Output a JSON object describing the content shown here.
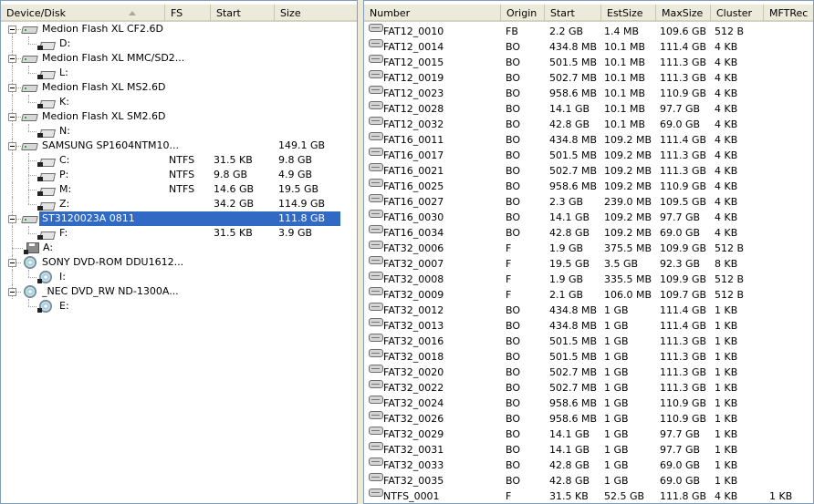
{
  "left_pane": {
    "columns": [
      "Device/Disk",
      "FS",
      "Start",
      "Size"
    ],
    "tree": [
      {
        "kind": "device",
        "icon": "hard-disk-icon",
        "label": "Medion Flash XL CF2.6D",
        "fs": "",
        "start": "",
        "size": "",
        "selected": false
      },
      {
        "kind": "volume",
        "icon": "volume-icon",
        "label": "D:",
        "fs": "",
        "start": "",
        "size": ""
      },
      {
        "kind": "device",
        "icon": "hard-disk-icon",
        "label": "Medion Flash XL MMC/SD2...",
        "fs": "",
        "start": "",
        "size": "",
        "selected": false
      },
      {
        "kind": "volume",
        "icon": "volume-icon",
        "label": "L:",
        "fs": "",
        "start": "",
        "size": ""
      },
      {
        "kind": "device",
        "icon": "hard-disk-icon",
        "label": "Medion Flash XL MS2.6D",
        "fs": "",
        "start": "",
        "size": "",
        "selected": false
      },
      {
        "kind": "volume",
        "icon": "volume-icon",
        "label": "K:",
        "fs": "",
        "start": "",
        "size": ""
      },
      {
        "kind": "device",
        "icon": "hard-disk-icon",
        "label": "Medion Flash XL SM2.6D",
        "fs": "",
        "start": "",
        "size": "",
        "selected": false
      },
      {
        "kind": "volume",
        "icon": "volume-icon",
        "label": "N:",
        "fs": "",
        "start": "",
        "size": ""
      },
      {
        "kind": "device",
        "icon": "hard-disk-icon",
        "label": "SAMSUNG SP1604NTM10...",
        "fs": "",
        "start": "",
        "size": "149.1 GB",
        "selected": false
      },
      {
        "kind": "volume",
        "icon": "volume-icon",
        "label": "C:",
        "fs": "NTFS",
        "start": "31.5 KB",
        "size": "9.8 GB"
      },
      {
        "kind": "volume",
        "icon": "volume-icon",
        "label": "P:",
        "fs": "NTFS",
        "start": "9.8 GB",
        "size": "4.9 GB"
      },
      {
        "kind": "volume",
        "icon": "volume-icon",
        "label": "M:",
        "fs": "NTFS",
        "start": "14.6 GB",
        "size": "19.5 GB"
      },
      {
        "kind": "volume",
        "icon": "volume-icon",
        "label": "Z:",
        "fs": "",
        "start": "34.2 GB",
        "size": "114.9 GB"
      },
      {
        "kind": "device",
        "icon": "hard-disk-icon",
        "label": "ST3120023A 0811",
        "fs": "",
        "start": "",
        "size": "111.8 GB",
        "selected": true
      },
      {
        "kind": "volume",
        "icon": "volume-icon",
        "label": "F:",
        "fs": "",
        "start": "31.5 KB",
        "size": "3.9 GB"
      },
      {
        "kind": "floppy",
        "icon": "floppy-icon",
        "label": "A:",
        "fs": "",
        "start": "",
        "size": ""
      },
      {
        "kind": "device",
        "icon": "cd-drive-icon",
        "label": "SONY DVD-ROM DDU1612...",
        "fs": "",
        "start": "",
        "size": "",
        "selected": false
      },
      {
        "kind": "volume",
        "icon": "cd-volume-icon",
        "label": "I:",
        "fs": "",
        "start": "",
        "size": ""
      },
      {
        "kind": "device",
        "icon": "cd-drive-icon",
        "label": "_NEC DVD_RW ND-1300A...",
        "fs": "",
        "start": "",
        "size": "",
        "selected": false
      },
      {
        "kind": "volume",
        "icon": "cd-volume-icon",
        "label": "E:",
        "fs": "",
        "start": "",
        "size": ""
      }
    ]
  },
  "right_pane": {
    "columns": [
      "Number",
      "Origin",
      "Start",
      "EstSize",
      "MaxSize",
      "Cluster",
      "MFTRec"
    ],
    "rows": [
      {
        "number": "FAT12_0010",
        "origin": "FB",
        "start": "2.2 GB",
        "estsize": "1.4 MB",
        "maxsize": "109.6 GB",
        "cluster": "512 B",
        "mftrec": ""
      },
      {
        "number": "FAT12_0014",
        "origin": "BO",
        "start": "434.8 MB",
        "estsize": "10.1 MB",
        "maxsize": "111.4 GB",
        "cluster": "4 KB",
        "mftrec": ""
      },
      {
        "number": "FAT12_0015",
        "origin": "BO",
        "start": "501.5 MB",
        "estsize": "10.1 MB",
        "maxsize": "111.3 GB",
        "cluster": "4 KB",
        "mftrec": ""
      },
      {
        "number": "FAT12_0019",
        "origin": "BO",
        "start": "502.7 MB",
        "estsize": "10.1 MB",
        "maxsize": "111.3 GB",
        "cluster": "4 KB",
        "mftrec": ""
      },
      {
        "number": "FAT12_0023",
        "origin": "BO",
        "start": "958.6 MB",
        "estsize": "10.1 MB",
        "maxsize": "110.9 GB",
        "cluster": "4 KB",
        "mftrec": ""
      },
      {
        "number": "FAT12_0028",
        "origin": "BO",
        "start": "14.1 GB",
        "estsize": "10.1 MB",
        "maxsize": "97.7 GB",
        "cluster": "4 KB",
        "mftrec": ""
      },
      {
        "number": "FAT12_0032",
        "origin": "BO",
        "start": "42.8 GB",
        "estsize": "10.1 MB",
        "maxsize": "69.0 GB",
        "cluster": "4 KB",
        "mftrec": ""
      },
      {
        "number": "FAT16_0011",
        "origin": "BO",
        "start": "434.8 MB",
        "estsize": "109.2 MB",
        "maxsize": "111.4 GB",
        "cluster": "4 KB",
        "mftrec": ""
      },
      {
        "number": "FAT16_0017",
        "origin": "BO",
        "start": "501.5 MB",
        "estsize": "109.2 MB",
        "maxsize": "111.3 GB",
        "cluster": "4 KB",
        "mftrec": ""
      },
      {
        "number": "FAT16_0021",
        "origin": "BO",
        "start": "502.7 MB",
        "estsize": "109.2 MB",
        "maxsize": "111.3 GB",
        "cluster": "4 KB",
        "mftrec": ""
      },
      {
        "number": "FAT16_0025",
        "origin": "BO",
        "start": "958.6 MB",
        "estsize": "109.2 MB",
        "maxsize": "110.9 GB",
        "cluster": "4 KB",
        "mftrec": ""
      },
      {
        "number": "FAT16_0027",
        "origin": "BO",
        "start": "2.3 GB",
        "estsize": "239.0 MB",
        "maxsize": "109.5 GB",
        "cluster": "4 KB",
        "mftrec": ""
      },
      {
        "number": "FAT16_0030",
        "origin": "BO",
        "start": "14.1 GB",
        "estsize": "109.2 MB",
        "maxsize": "97.7 GB",
        "cluster": "4 KB",
        "mftrec": ""
      },
      {
        "number": "FAT16_0034",
        "origin": "BO",
        "start": "42.8 GB",
        "estsize": "109.2 MB",
        "maxsize": "69.0 GB",
        "cluster": "4 KB",
        "mftrec": ""
      },
      {
        "number": "FAT32_0006",
        "origin": "F",
        "start": "1.9 GB",
        "estsize": "375.5 MB",
        "maxsize": "109.9 GB",
        "cluster": "512 B",
        "mftrec": ""
      },
      {
        "number": "FAT32_0007",
        "origin": "F",
        "start": "19.5 GB",
        "estsize": "3.5 GB",
        "maxsize": "92.3 GB",
        "cluster": "8 KB",
        "mftrec": ""
      },
      {
        "number": "FAT32_0008",
        "origin": "F",
        "start": "1.9 GB",
        "estsize": "335.5 MB",
        "maxsize": "109.9 GB",
        "cluster": "512 B",
        "mftrec": ""
      },
      {
        "number": "FAT32_0009",
        "origin": "F",
        "start": "2.1 GB",
        "estsize": "106.0 MB",
        "maxsize": "109.7 GB",
        "cluster": "512 B",
        "mftrec": ""
      },
      {
        "number": "FAT32_0012",
        "origin": "BO",
        "start": "434.8 MB",
        "estsize": "1 GB",
        "maxsize": "111.4 GB",
        "cluster": "1 KB",
        "mftrec": ""
      },
      {
        "number": "FAT32_0013",
        "origin": "BO",
        "start": "434.8 MB",
        "estsize": "1 GB",
        "maxsize": "111.4 GB",
        "cluster": "1 KB",
        "mftrec": ""
      },
      {
        "number": "FAT32_0016",
        "origin": "BO",
        "start": "501.5 MB",
        "estsize": "1 GB",
        "maxsize": "111.3 GB",
        "cluster": "1 KB",
        "mftrec": ""
      },
      {
        "number": "FAT32_0018",
        "origin": "BO",
        "start": "501.5 MB",
        "estsize": "1 GB",
        "maxsize": "111.3 GB",
        "cluster": "1 KB",
        "mftrec": ""
      },
      {
        "number": "FAT32_0020",
        "origin": "BO",
        "start": "502.7 MB",
        "estsize": "1 GB",
        "maxsize": "111.3 GB",
        "cluster": "1 KB",
        "mftrec": ""
      },
      {
        "number": "FAT32_0022",
        "origin": "BO",
        "start": "502.7 MB",
        "estsize": "1 GB",
        "maxsize": "111.3 GB",
        "cluster": "1 KB",
        "mftrec": ""
      },
      {
        "number": "FAT32_0024",
        "origin": "BO",
        "start": "958.6 MB",
        "estsize": "1 GB",
        "maxsize": "110.9 GB",
        "cluster": "1 KB",
        "mftrec": ""
      },
      {
        "number": "FAT32_0026",
        "origin": "BO",
        "start": "958.6 MB",
        "estsize": "1 GB",
        "maxsize": "110.9 GB",
        "cluster": "1 KB",
        "mftrec": ""
      },
      {
        "number": "FAT32_0029",
        "origin": "BO",
        "start": "14.1 GB",
        "estsize": "1 GB",
        "maxsize": "97.7 GB",
        "cluster": "1 KB",
        "mftrec": ""
      },
      {
        "number": "FAT32_0031",
        "origin": "BO",
        "start": "14.1 GB",
        "estsize": "1 GB",
        "maxsize": "97.7 GB",
        "cluster": "1 KB",
        "mftrec": ""
      },
      {
        "number": "FAT32_0033",
        "origin": "BO",
        "start": "42.8 GB",
        "estsize": "1 GB",
        "maxsize": "69.0 GB",
        "cluster": "1 KB",
        "mftrec": ""
      },
      {
        "number": "FAT32_0035",
        "origin": "BO",
        "start": "42.8 GB",
        "estsize": "1 GB",
        "maxsize": "69.0 GB",
        "cluster": "1 KB",
        "mftrec": ""
      },
      {
        "number": "NTFS_0001",
        "origin": "F",
        "start": "31.5 KB",
        "estsize": "52.5 GB",
        "maxsize": "111.8 GB",
        "cluster": "4 KB",
        "mftrec": "1 KB"
      }
    ]
  },
  "colors": {
    "selection": "#316ac5",
    "header_bg": "#ebeadb",
    "splitter": "#ece9d8",
    "border": "#7f9db9"
  }
}
